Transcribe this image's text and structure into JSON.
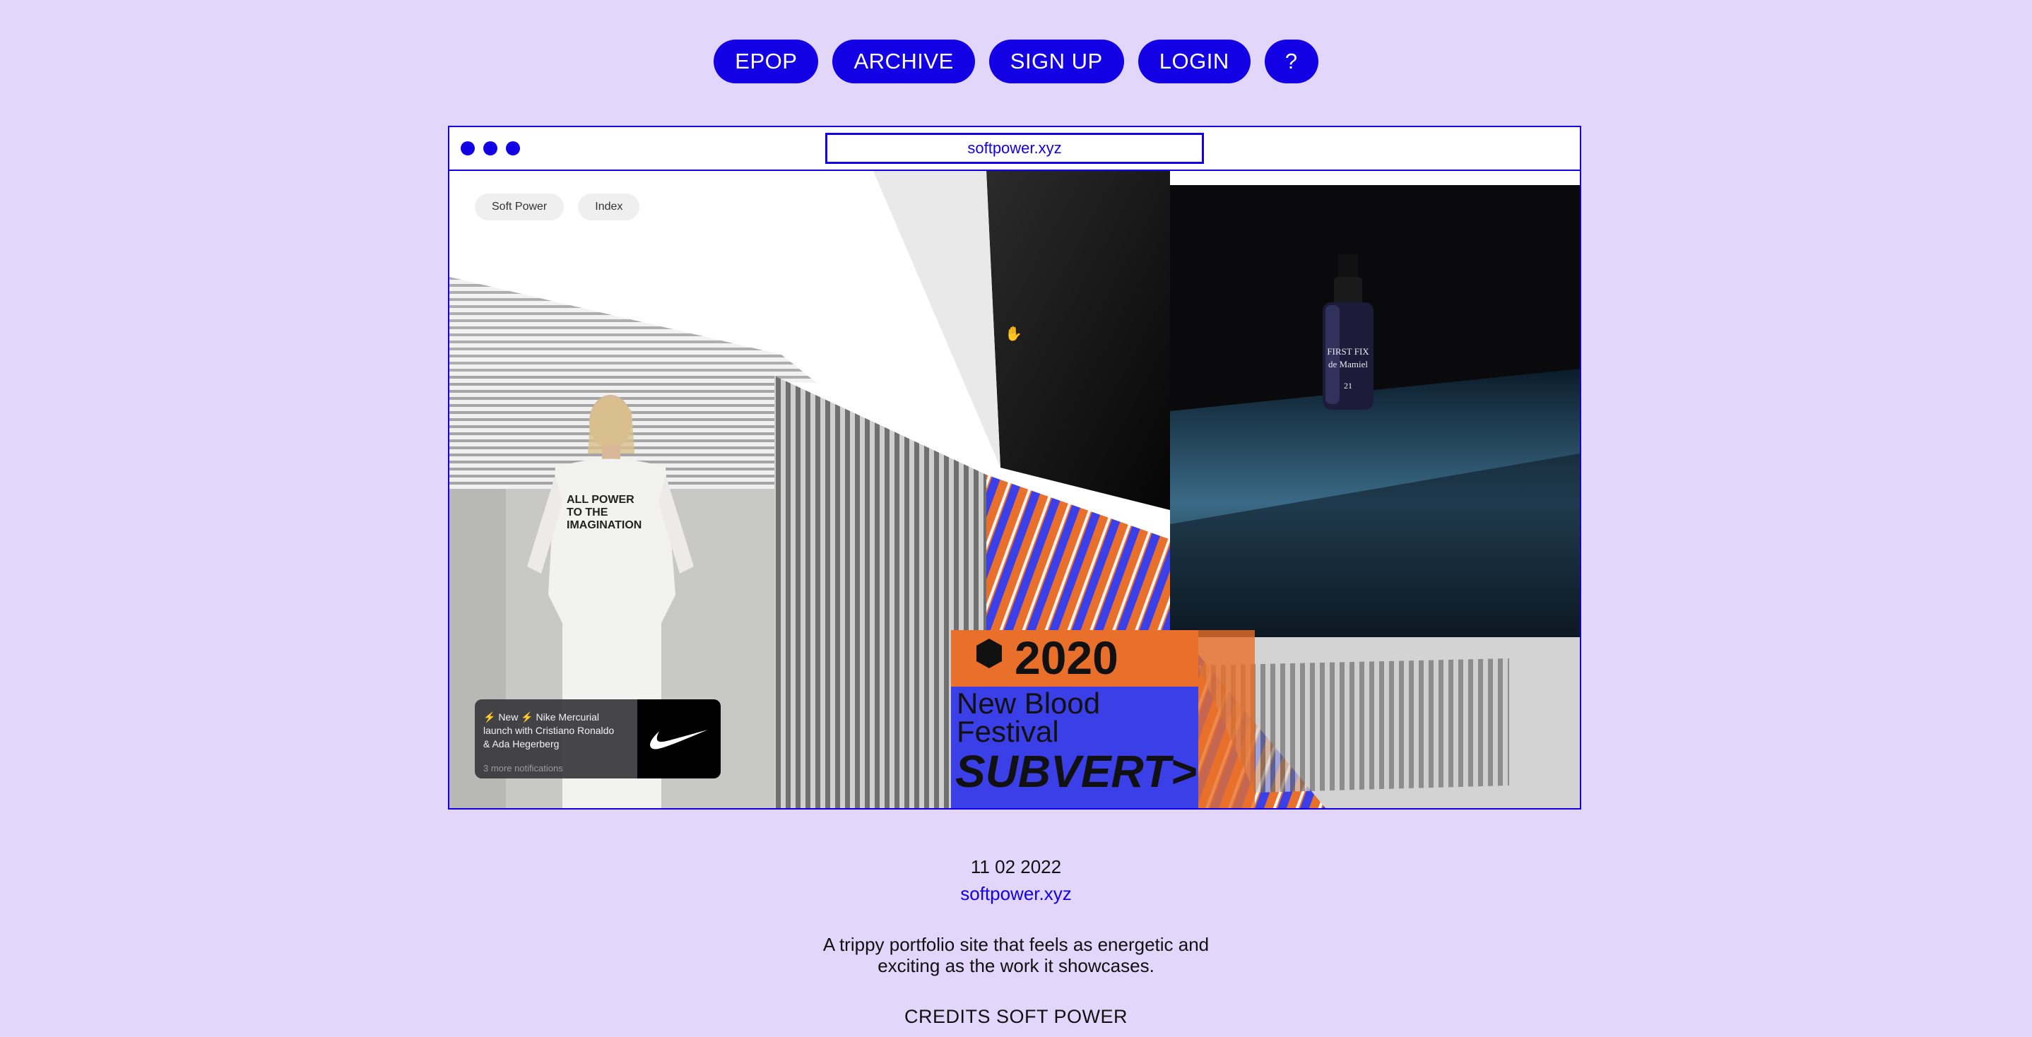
{
  "nav": {
    "buttons": [
      "EPOP",
      "ARCHIVE",
      "SIGN UP",
      "LOGIN",
      "?"
    ]
  },
  "browser": {
    "url": "softpower.xyz",
    "site_nav": [
      "Soft Power",
      "Index"
    ],
    "notification": {
      "line1": "⚡ New ⚡ Nike Mercurial",
      "line2": "launch with Cristiano Ronaldo",
      "line3": "& Ada Hegerberg",
      "more": "3 more notifications",
      "logo_icon": "nike-swoosh-icon"
    },
    "collage": {
      "shirt_text": [
        "ALL POWER",
        "TO THE",
        "IMAGINATION"
      ],
      "product_label": [
        "FIRST FIX",
        "de Mamiel",
        "21"
      ],
      "festival": {
        "year": "2020",
        "line1": "New Blood",
        "line2": "Festival",
        "line3": "SUBVERT>"
      }
    }
  },
  "entry": {
    "date": "11 02 2022",
    "link": "softpower.xyz",
    "description_line1": "A trippy portfolio site that feels as energetic and",
    "description_line2": "exciting as the work it showcases.",
    "credits": "CREDITS SOFT POWER"
  },
  "colors": {
    "background": "#e3d6fb",
    "accent": "#1400e5",
    "orange": "#e8702a"
  }
}
